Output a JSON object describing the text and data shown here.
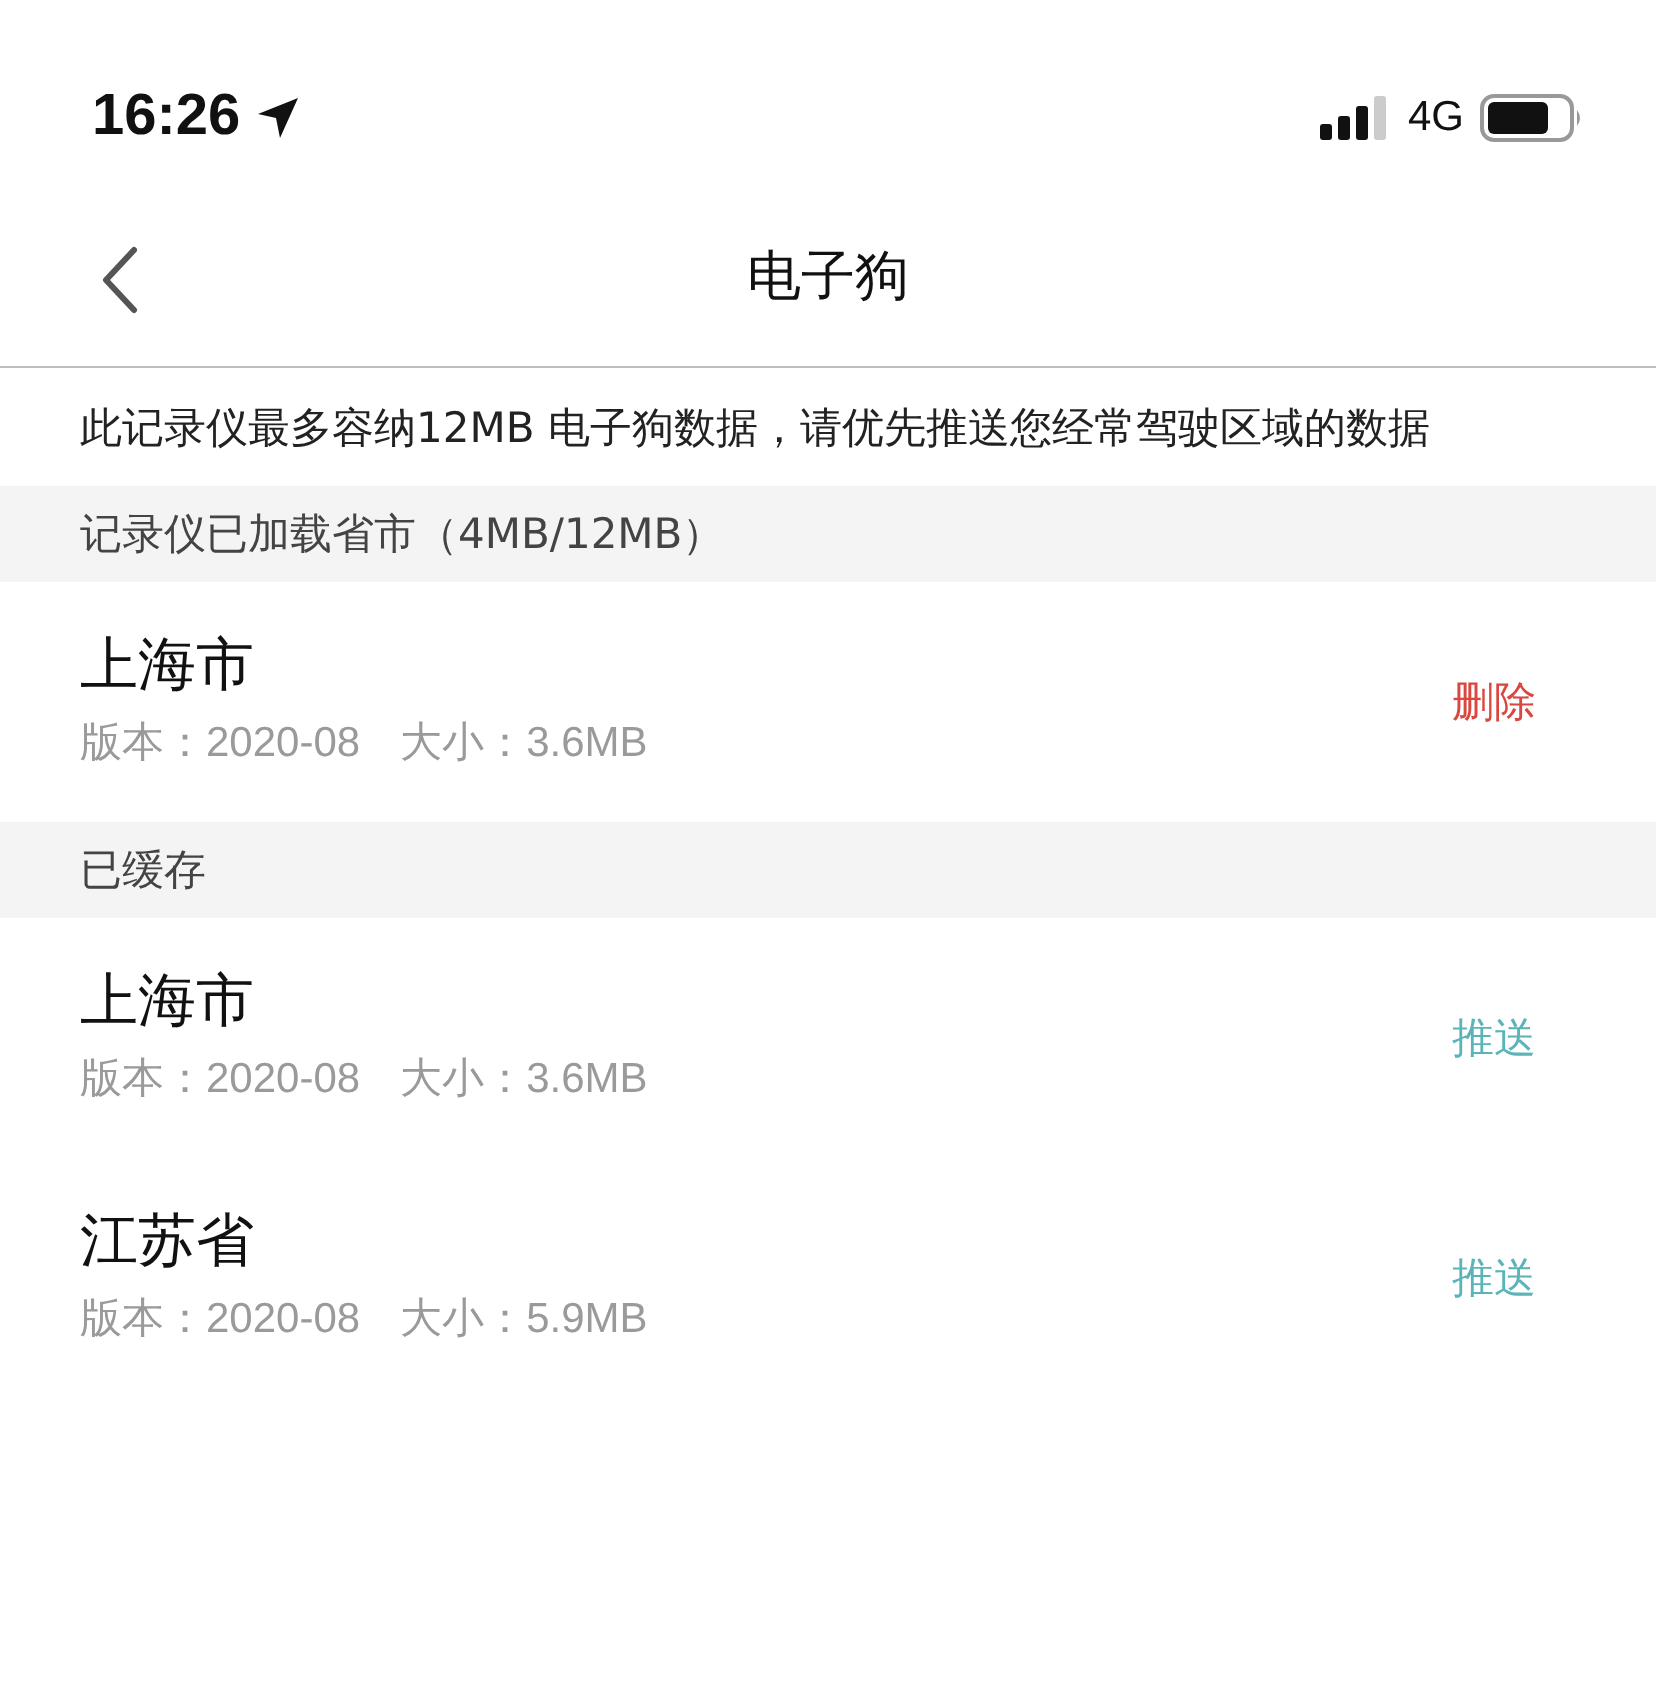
{
  "status_bar": {
    "time": "16:26",
    "network": "4G"
  },
  "nav": {
    "title": "电子狗"
  },
  "notice": "此记录仪最多容纳12MB 电子狗数据，请优先推送您经常驾驶区域的数据",
  "sections": [
    {
      "header": "记录仪已加载省市（4MB/12MB）",
      "items": [
        {
          "name": "上海市",
          "version": "版本：2020-08",
          "size": "大小：3.6MB",
          "action": {
            "kind": "delete",
            "label": "删除"
          }
        }
      ]
    },
    {
      "header": "已缓存",
      "items": [
        {
          "name": "上海市",
          "version": "版本：2020-08",
          "size": "大小：3.6MB",
          "action": {
            "kind": "push",
            "label": "推送"
          }
        },
        {
          "name": "江苏省",
          "version": "版本：2020-08",
          "size": "大小：5.9MB",
          "action": {
            "kind": "push",
            "label": "推送"
          }
        }
      ]
    }
  ]
}
